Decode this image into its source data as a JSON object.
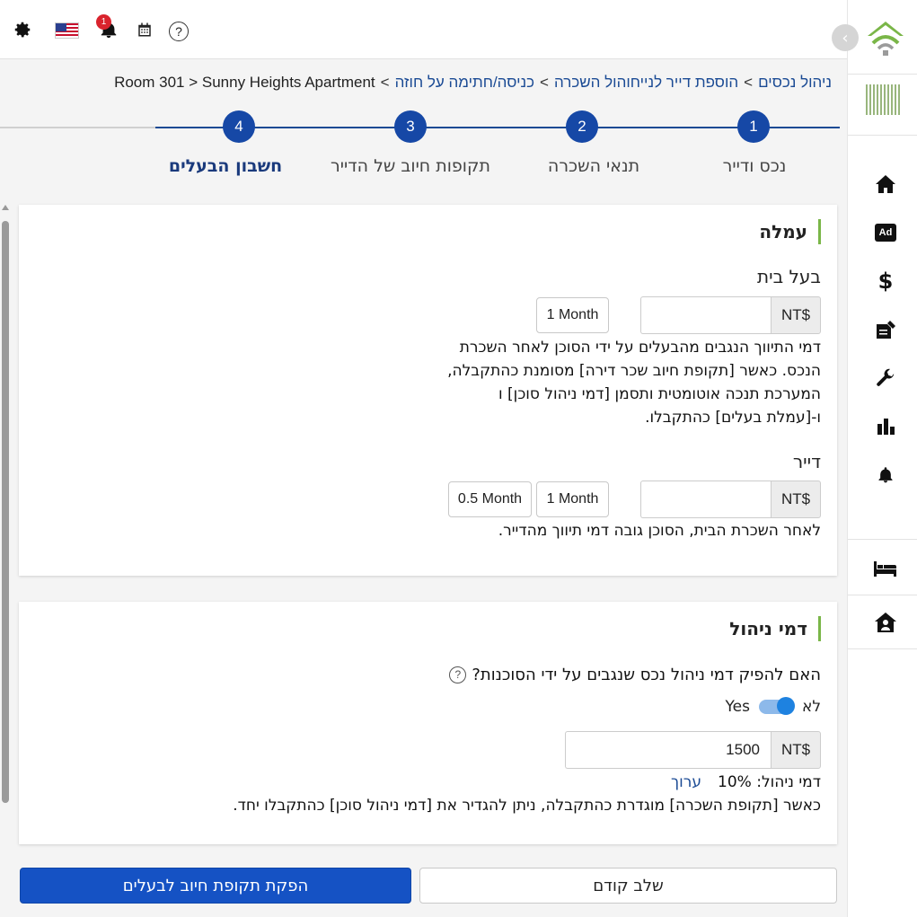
{
  "breadcrumb": {
    "items": [
      "ניהול נכסים",
      "הוספת דייר לנייחוהול השכרה",
      "כניסה/חתימה על חוזה"
    ],
    "current": "Room 301 > Sunny Heights Apartment",
    "separator": ">"
  },
  "topbar": {
    "notification_count": "1",
    "help": "?"
  },
  "steps": [
    {
      "number": "1",
      "label": "נכס ודייר"
    },
    {
      "number": "2",
      "label": "תנאי השכרה"
    },
    {
      "number": "3",
      "label": "תקופות חיוב של הדייר"
    },
    {
      "number": "4",
      "label": "חשבון הבעלים"
    }
  ],
  "commission": {
    "title": "עמלה",
    "landlord": {
      "label": "בעל בית",
      "currency": "NT$",
      "value": "",
      "month_option": "1 Month",
      "description_lines": [
        "דמי התיווך הנגבים מהבעלים על ידי הסוכן לאחר השכרת",
        "הנכס. כאשר [תקופת חיוב שכר דירה] מסומנת כהתקבלה,",
        "המערכת תנכה אוטומטית ותסמן [דמי ניהול סוכן] ו",
        "ו-[עמלת בעלים] כהתקבלו."
      ]
    },
    "tenant": {
      "label": "דייר",
      "currency": "NT$",
      "value": "",
      "month_options": [
        "1 Month",
        "0.5 Month"
      ],
      "description": "לאחר השכרת הבית, הסוכן גובה דמי תיווך מהדייר."
    }
  },
  "management": {
    "title": "דמי ניהול",
    "question": "האם להפיק דמי ניהול נכס שנגבים על ידי הסוכנות?",
    "help": "?",
    "toggle_no": "לא",
    "toggle_yes": "Yes",
    "toggle_on": true,
    "currency": "NT$",
    "amount": "1500",
    "fee_label": "דמי ניהול: 10%",
    "edit_link": "ערוך",
    "note": "כאשר [תקופת השכרה] מוגדרת כהתקבלה, ניתן להגדיר את [דמי ניהול סוכן] כהתקבלו יחד."
  },
  "buttons": {
    "previous": "שלב קודם",
    "generate": "הפקת תקופת חיוב לבעלים"
  },
  "colors": {
    "primary": "#1552c4",
    "step": "#1648a6",
    "accent_bar": "#7ab648",
    "badge": "#d9232d"
  }
}
